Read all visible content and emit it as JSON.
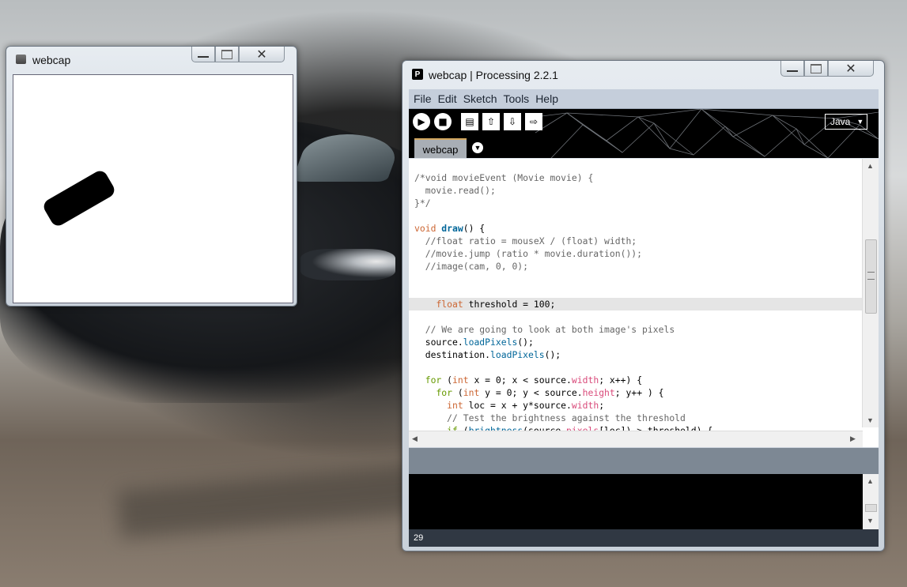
{
  "sketch_window": {
    "title": "webcap"
  },
  "pde_window": {
    "title": "webcap | Processing 2.2.1",
    "menu": [
      "File",
      "Edit",
      "Sketch",
      "Tools",
      "Help"
    ],
    "mode": "Java",
    "tab_label": "webcap",
    "line_number": "29"
  },
  "code_lines": [
    "/*void movieEvent (Movie movie) {",
    "  movie.read();",
    "}*/",
    "",
    "void draw() {",
    "  //float ratio = mouseX / (float) width;",
    "  //movie.jump (ratio * movie.duration());",
    "  //image(cam, 0, 0);",
    "",
    "",
    "    float threshold = 100;",
    "",
    "  // We are going to look at both image's pixels",
    "  source.loadPixels();",
    "  destination.loadPixels();",
    "",
    "  for (int x = 0; x < source.width; x++) {",
    "    for (int y = 0; y < source.height; y++ ) {",
    "      int loc = x + y*source.width;",
    "      // Test the brightness against the threshold",
    "      if (brightness(source.pixels[loc]) > threshold) {"
  ]
}
